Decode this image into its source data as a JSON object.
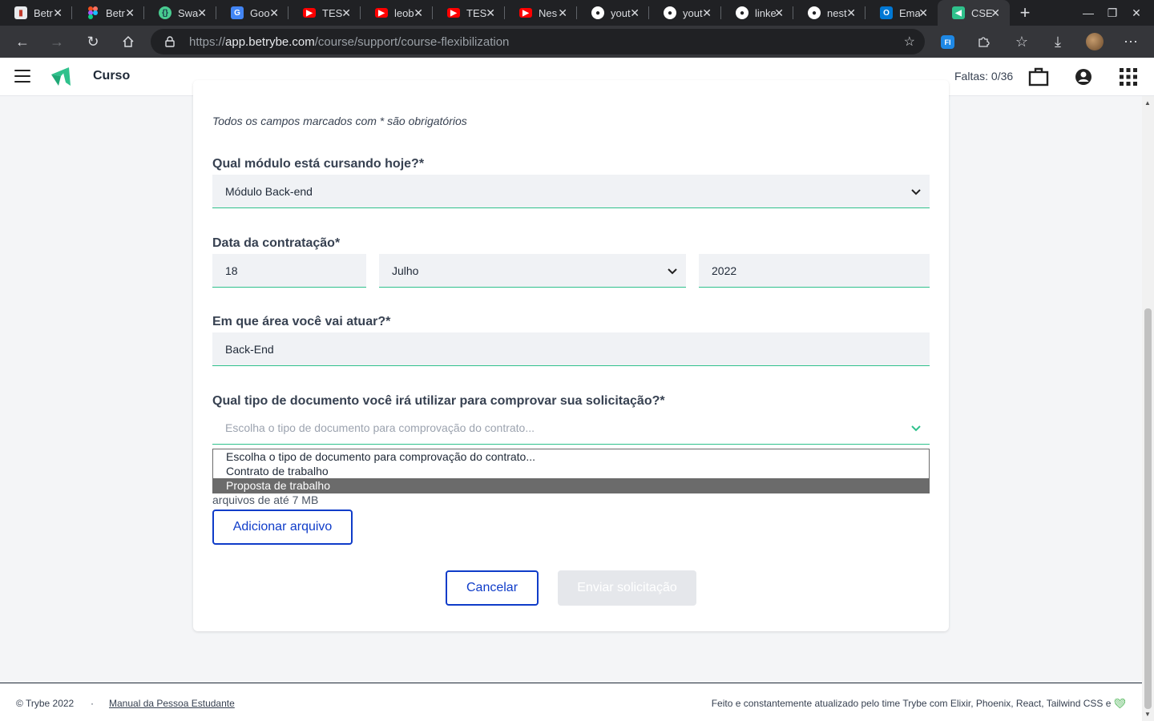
{
  "browser": {
    "tabs": [
      {
        "label": "Betr",
        "icon": "trybe-book-icon",
        "color": "#e8eaed"
      },
      {
        "label": "Betr",
        "icon": "figma-icon",
        "color": "#f24e1e"
      },
      {
        "label": "Swa",
        "icon": "swagger-icon",
        "color": "#49cc90"
      },
      {
        "label": "Goo",
        "icon": "google-translate-icon",
        "color": "#4285f4"
      },
      {
        "label": "TES",
        "icon": "youtube-icon",
        "color": "#ff0000"
      },
      {
        "label": "leob",
        "icon": "youtube-icon",
        "color": "#ff0000"
      },
      {
        "label": "TES",
        "icon": "youtube-icon",
        "color": "#ff0000"
      },
      {
        "label": "Nes",
        "icon": "youtube-icon",
        "color": "#ff0000"
      },
      {
        "label": "yout",
        "icon": "github-icon",
        "color": "#ffffff"
      },
      {
        "label": "yout",
        "icon": "github-icon",
        "color": "#ffffff"
      },
      {
        "label": "linke",
        "icon": "github-icon",
        "color": "#ffffff"
      },
      {
        "label": "nest",
        "icon": "github-icon",
        "color": "#ffffff"
      },
      {
        "label": "Ema",
        "icon": "outlook-icon",
        "color": "#0078d4"
      },
      {
        "label": "CSE",
        "icon": "trybe-icon",
        "color": "#2fc18c",
        "active": true
      }
    ],
    "url_scheme": "https://",
    "url_host": "app.betrybe.com",
    "url_path": "/course/support/course-flexibilization",
    "extension_label": "FI"
  },
  "header": {
    "title": "Curso",
    "faltas": "Faltas: 0/36",
    "brand_color": "#2fc18c"
  },
  "form": {
    "required_note": "Todos os campos marcados com * são obrigatórios",
    "module_label": "Qual módulo está cursando hoje?*",
    "module_value": "Módulo Back-end",
    "date_label": "Data da contratação*",
    "date_day": "18",
    "date_month": "Julho",
    "date_year": "2022",
    "area_label": "Em que área você vai atuar?*",
    "area_value": "Back-End",
    "doc_label": "Qual tipo de documento você irá utilizar para comprovar sua solicitação?*",
    "doc_placeholder": "Escolha o tipo de documento para comprovação do contrato...",
    "doc_options": [
      "Escolha o tipo de documento para comprovação do contrato...",
      "Contrato de trabalho",
      "Proposta de trabalho"
    ],
    "doc_highlighted": "Proposta de trabalho",
    "file_note": "arquivos de até 7 MB",
    "add_file_button": "Adicionar arquivo",
    "cancel_button": "Cancelar",
    "submit_button": "Enviar solicitação"
  },
  "footer": {
    "copyright": "© Trybe 2022",
    "separator": "·",
    "manual_link": "Manual da Pessoa Estudante",
    "made_with": "Feito e constantemente atualizado pelo time Trybe com Elixir, Phoenix, React, Tailwind CSS e",
    "heart_icon": "green-heart-icon"
  },
  "colors": {
    "accent_green": "#2fc18c",
    "accent_blue": "#0f3cc9"
  }
}
